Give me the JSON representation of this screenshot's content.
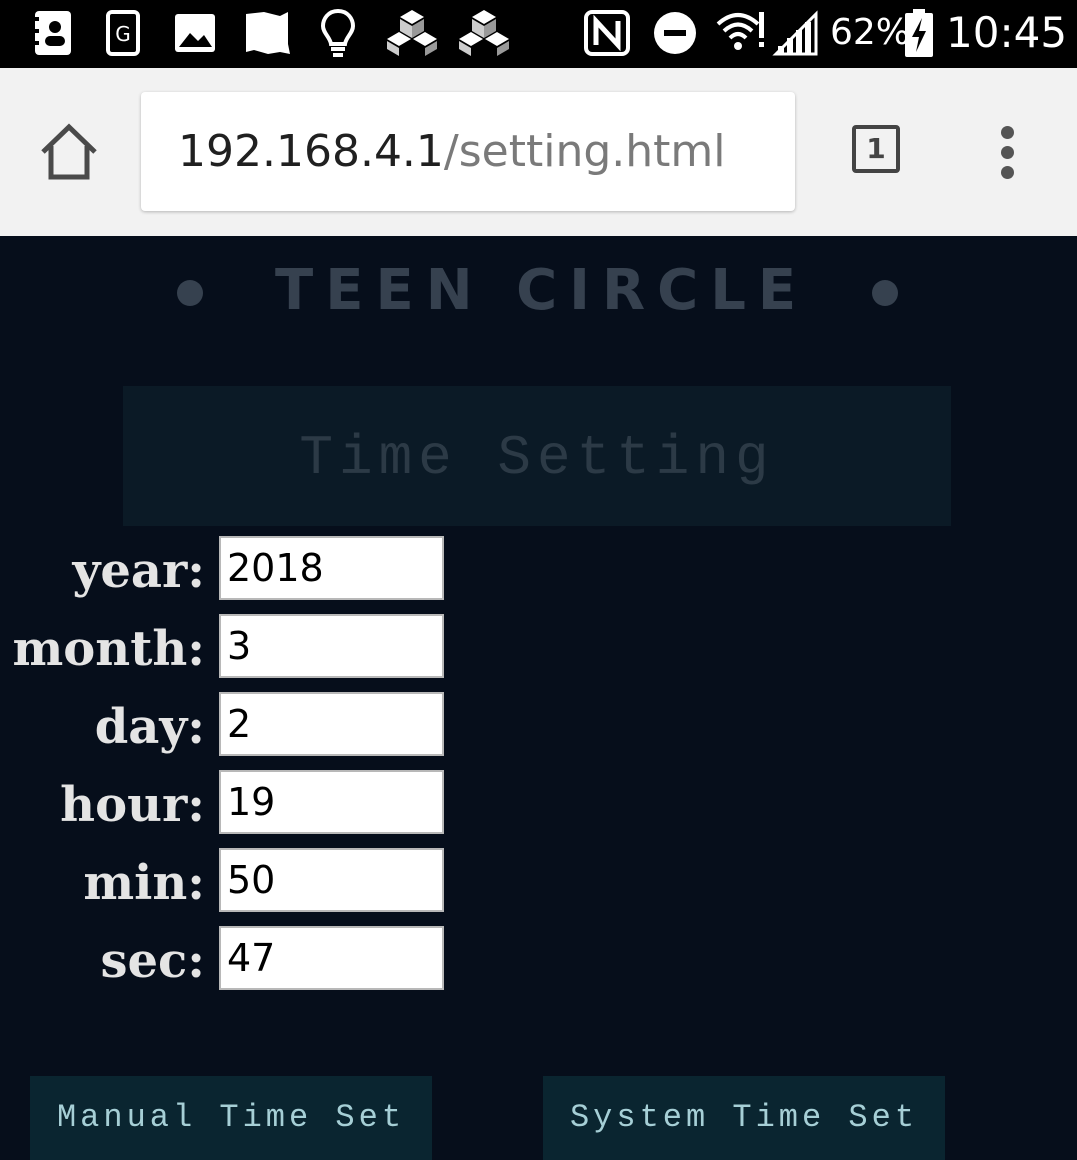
{
  "status_bar": {
    "icons": [
      "contacts-app-icon",
      "sim-card-icon",
      "gallery-icon",
      "map-icon",
      "lightbulb-icon",
      "cubes-icon",
      "cubes-icon",
      "nfc-icon",
      "do-not-disturb-icon",
      "wifi-icon",
      "signal-icon",
      "battery-charging-icon"
    ],
    "battery": "62%",
    "time": "10:45"
  },
  "browser": {
    "url_host": "192.168.4.1",
    "url_path": "/setting.html",
    "tab_count": "1"
  },
  "page": {
    "brand": "TEEN CIRCLE",
    "heading": "Time Setting",
    "fields": [
      {
        "label": "year:",
        "value": "2018"
      },
      {
        "label": "month:",
        "value": "3"
      },
      {
        "label": "day:",
        "value": "2"
      },
      {
        "label": "hour:",
        "value": "19"
      },
      {
        "label": "min:",
        "value": "50"
      },
      {
        "label": "sec:",
        "value": "47"
      }
    ],
    "manual_button": "Manual Time Set",
    "system_button": "System Time Set"
  },
  "colors": {
    "page_background": "#060e1b",
    "banner_background": "#0b1a26",
    "button_background": "#0a2530",
    "button_text": "#a6cfd6"
  }
}
